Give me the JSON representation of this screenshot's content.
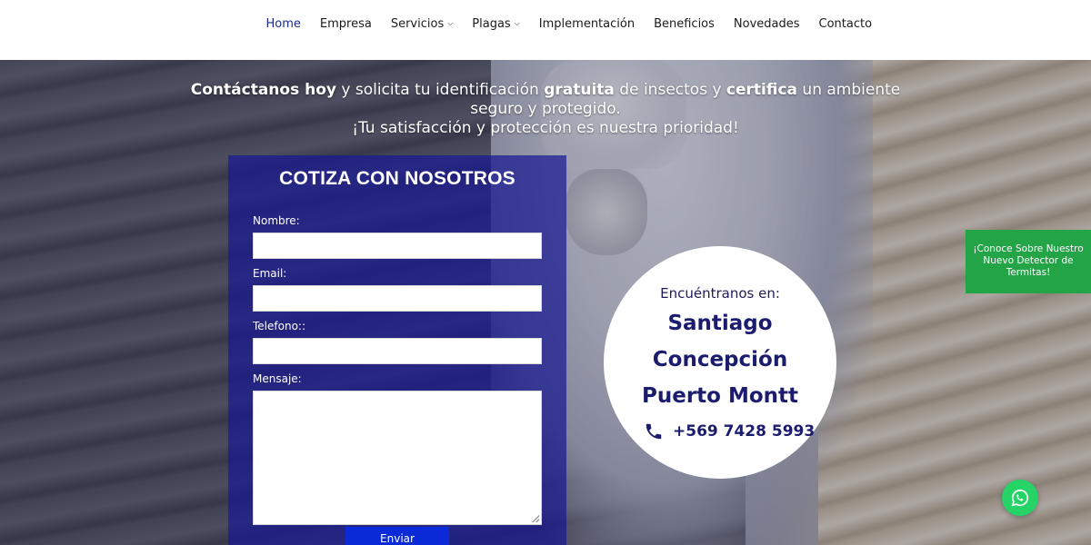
{
  "nav": {
    "items": [
      {
        "label": "Home",
        "active": true,
        "dropdown": false
      },
      {
        "label": "Empresa",
        "active": false,
        "dropdown": false
      },
      {
        "label": "Servicios",
        "active": false,
        "dropdown": true
      },
      {
        "label": "Plagas",
        "active": false,
        "dropdown": true
      },
      {
        "label": "Implementación",
        "active": false,
        "dropdown": false
      },
      {
        "label": "Beneficios",
        "active": false,
        "dropdown": false
      },
      {
        "label": "Novedades",
        "active": false,
        "dropdown": false
      },
      {
        "label": "Contacto",
        "active": false,
        "dropdown": false
      }
    ]
  },
  "hero": {
    "line1_bold1": "Contáctanos hoy",
    "line1_text1": " y solicita tu identificación ",
    "line1_bold2": "gratuita",
    "line1_text2": " de insectos y ",
    "line1_bold3": "certifica",
    "line1_text3": " un ambiente",
    "line2": "seguro y protegido.",
    "line3": "¡Tu satisfacción y protección es nuestra prioridad!"
  },
  "form": {
    "title": "COTIZA CON NOSOTROS",
    "name_label": "Nombre:",
    "email_label": "Email:",
    "phone_label": "Telefono::",
    "message_label": "Mensaje:",
    "submit_label": "Enviar"
  },
  "locations": {
    "header": "Encuéntranos en:",
    "cities": [
      "Santiago",
      "Concepción",
      "Puerto Montt"
    ],
    "phone": "+569 7428 5993"
  },
  "side_cta": {
    "label": "¡Conoce Sobre Nuestro Nuevo Detector de Termitas!"
  },
  "colors": {
    "nav_active": "#1e2a8a",
    "form_panel": "#19198f",
    "submit_button": "#0b2ad8",
    "location_text": "#1c1c6e",
    "side_cta": "#22a447",
    "whatsapp": "#25d366"
  },
  "icons": {
    "phone": "phone-icon",
    "whatsapp": "whatsapp-icon",
    "dropdown": "chevron-down-icon"
  }
}
